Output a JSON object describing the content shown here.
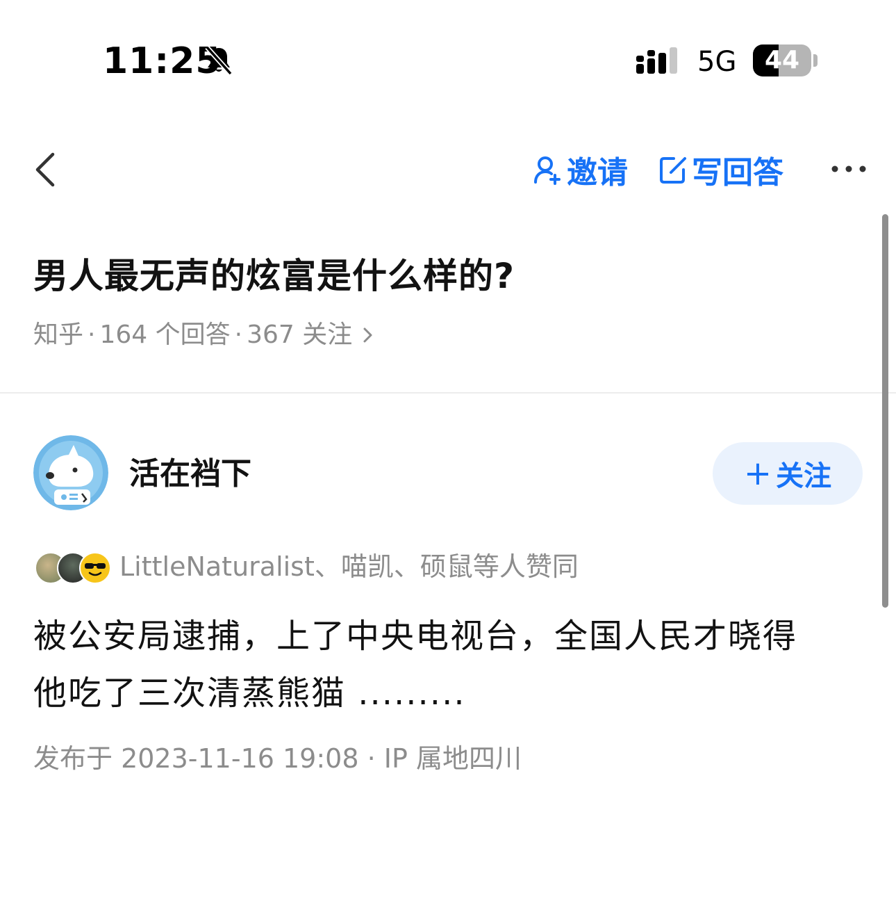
{
  "status_bar": {
    "time": "11:25",
    "network": "5G",
    "battery_level": "44",
    "battery_fraction": 0.44,
    "icons": [
      "bell-slash-icon",
      "signal-icon"
    ]
  },
  "nav": {
    "back_icon": "chevron-left-icon",
    "invite_label": "邀请",
    "invite_icon": "person-plus-icon",
    "write_answer_label": "写回答",
    "write_icon": "edit-icon",
    "more_icon": "more-dots-icon",
    "accent_color": "#1772f6"
  },
  "question": {
    "title": "男人最无声的炫富是什么样的?",
    "source": "知乎",
    "answers_count": "164 个回答",
    "followers_count": "367 关注",
    "separator": "·"
  },
  "answer": {
    "author_name": "活在裆下",
    "follow_label": "关注",
    "follow_prefix": "+",
    "voters_text": "LittleNaturalist、喵凯、硕鼠等人赞同",
    "body_lines": [
      "被公安局逮捕，上了中央电视台，全国人民才晓得",
      "他吃了三次清蒸熊猫 ........."
    ],
    "publish_info": "发布于 2023-11-16 19:08 · IP 属地四川"
  }
}
